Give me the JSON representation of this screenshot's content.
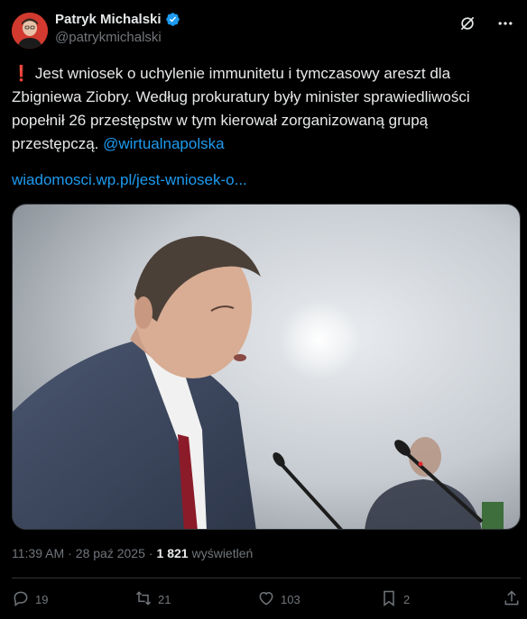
{
  "author": {
    "name": "Patryk Michalski",
    "handle": "@patrykmichalski"
  },
  "tweet": {
    "emoji": "❗",
    "text_main": "Jest wniosek o uchylenie immunitetu i tymczasowy areszt dla Zbigniewa Ziobry. Według prokuratury były minister sprawiedliwości popełnił 26 przestępstw w tym kierował zorganizowaną grupą przestępczą.",
    "mention": "@wirtualnapolska",
    "link": "wiadomosci.wp.pl/jest-wniosek-o..."
  },
  "meta": {
    "time": "11:39 AM",
    "separator": "·",
    "date": "28 paź 2025",
    "separator2": "·",
    "views_count": "1 821",
    "views_label": "wyświetleń"
  },
  "actions": {
    "replies": "19",
    "reposts": "21",
    "likes": "103",
    "bookmarks": "2"
  },
  "colors": {
    "accent": "#1d9bf0",
    "muted": "#71767b",
    "background": "#000000"
  },
  "icons": {
    "verified": "verified-badge-icon",
    "grok": "grok-icon",
    "more": "more-icon",
    "reply": "reply-icon",
    "repost": "repost-icon",
    "like": "like-icon",
    "bookmark": "bookmark-icon",
    "share": "share-icon"
  }
}
